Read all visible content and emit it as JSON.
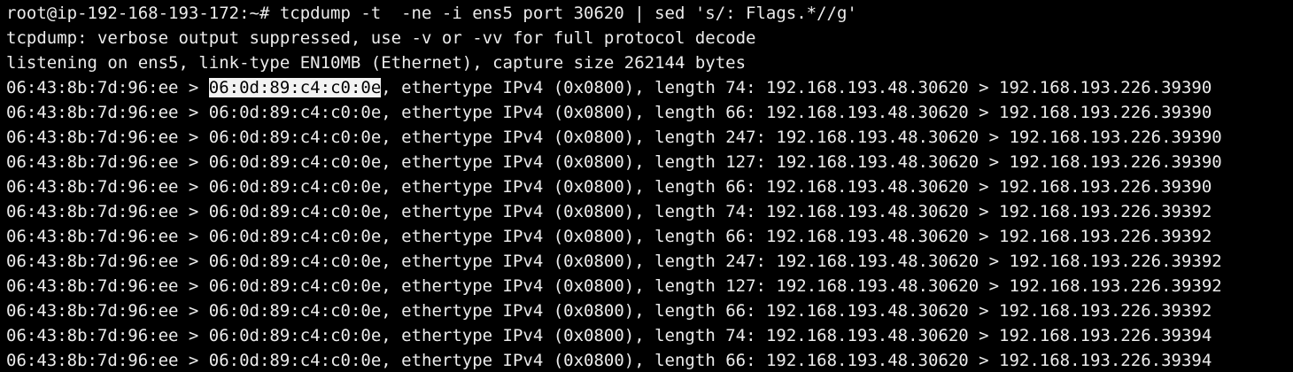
{
  "terminal": {
    "colors": {
      "background": "#000000",
      "foreground": "#ececec",
      "selection_bg": "#f2f2f2",
      "selection_fg": "#000000"
    },
    "prompt_line": "root@ip-192-168-193-172:~# tcpdump -t  -ne -i ens5 port 30620 | sed 's/: Flags.*//g'",
    "info_lines": [
      "tcpdump: verbose output suppressed, use -v or -vv for full protocol decode",
      "listening on ens5, link-type EN10MB (Ethernet), capture size 262144 bytes"
    ],
    "packets": [
      {
        "src_mac": "06:43:8b:7d:96:ee",
        "dst_mac": "06:0d:89:c4:c0:0e",
        "rest": ", ethertype IPv4 (0x0800), length 74: 192.168.193.48.30620 > 192.168.193.226.39390",
        "selected": true
      },
      {
        "src_mac": "06:43:8b:7d:96:ee",
        "dst_mac": "06:0d:89:c4:c0:0e",
        "rest": ", ethertype IPv4 (0x0800), length 66: 192.168.193.48.30620 > 192.168.193.226.39390",
        "selected": false
      },
      {
        "src_mac": "06:43:8b:7d:96:ee",
        "dst_mac": "06:0d:89:c4:c0:0e",
        "rest": ", ethertype IPv4 (0x0800), length 247: 192.168.193.48.30620 > 192.168.193.226.39390",
        "selected": false
      },
      {
        "src_mac": "06:43:8b:7d:96:ee",
        "dst_mac": "06:0d:89:c4:c0:0e",
        "rest": ", ethertype IPv4 (0x0800), length 127: 192.168.193.48.30620 > 192.168.193.226.39390",
        "selected": false
      },
      {
        "src_mac": "06:43:8b:7d:96:ee",
        "dst_mac": "06:0d:89:c4:c0:0e",
        "rest": ", ethertype IPv4 (0x0800), length 66: 192.168.193.48.30620 > 192.168.193.226.39390",
        "selected": false
      },
      {
        "src_mac": "06:43:8b:7d:96:ee",
        "dst_mac": "06:0d:89:c4:c0:0e",
        "rest": ", ethertype IPv4 (0x0800), length 74: 192.168.193.48.30620 > 192.168.193.226.39392",
        "selected": false
      },
      {
        "src_mac": "06:43:8b:7d:96:ee",
        "dst_mac": "06:0d:89:c4:c0:0e",
        "rest": ", ethertype IPv4 (0x0800), length 66: 192.168.193.48.30620 > 192.168.193.226.39392",
        "selected": false
      },
      {
        "src_mac": "06:43:8b:7d:96:ee",
        "dst_mac": "06:0d:89:c4:c0:0e",
        "rest": ", ethertype IPv4 (0x0800), length 247: 192.168.193.48.30620 > 192.168.193.226.39392",
        "selected": false
      },
      {
        "src_mac": "06:43:8b:7d:96:ee",
        "dst_mac": "06:0d:89:c4:c0:0e",
        "rest": ", ethertype IPv4 (0x0800), length 127: 192.168.193.48.30620 > 192.168.193.226.39392",
        "selected": false
      },
      {
        "src_mac": "06:43:8b:7d:96:ee",
        "dst_mac": "06:0d:89:c4:c0:0e",
        "rest": ", ethertype IPv4 (0x0800), length 66: 192.168.193.48.30620 > 192.168.193.226.39392",
        "selected": false
      },
      {
        "src_mac": "06:43:8b:7d:96:ee",
        "dst_mac": "06:0d:89:c4:c0:0e",
        "rest": ", ethertype IPv4 (0x0800), length 74: 192.168.193.48.30620 > 192.168.193.226.39394",
        "selected": false
      },
      {
        "src_mac": "06:43:8b:7d:96:ee",
        "dst_mac": "06:0d:89:c4:c0:0e",
        "rest": ", ethertype IPv4 (0x0800), length 66: 192.168.193.48.30620 > 192.168.193.226.39394",
        "selected": false
      }
    ]
  }
}
